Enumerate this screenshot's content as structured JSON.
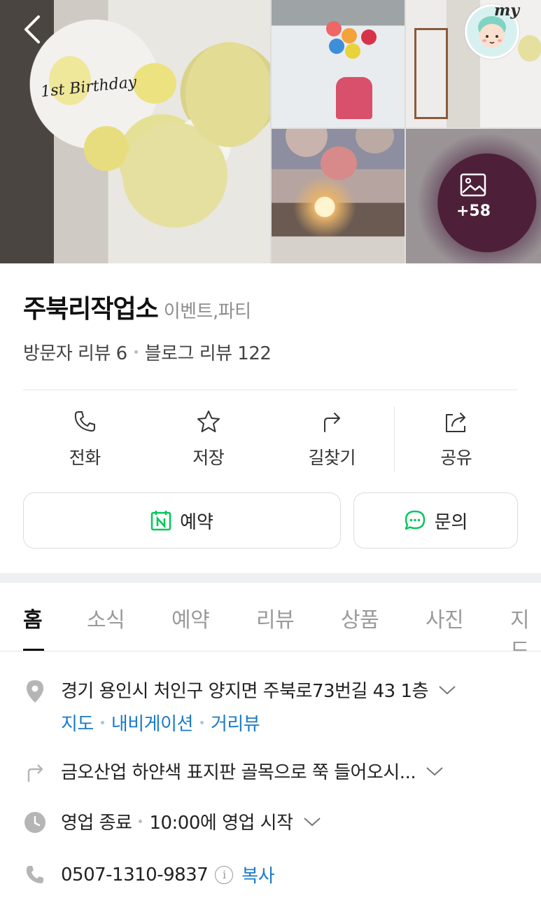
{
  "gallery": {
    "main_photo_caption": "1st Birthday",
    "more_photos_count": "+58",
    "my_label": "my"
  },
  "place": {
    "name": "주북리작업소",
    "category": "이벤트,파티",
    "visitor_reviews": "방문자 리뷰 6",
    "blog_reviews": "블로그 리뷰 122"
  },
  "actions": [
    {
      "label": "전화",
      "icon": "phone-icon"
    },
    {
      "label": "저장",
      "icon": "star-icon"
    },
    {
      "label": "길찾기",
      "icon": "directions-icon"
    },
    {
      "label": "공유",
      "icon": "share-icon"
    }
  ],
  "buttons": {
    "reserve": "예약",
    "inquiry": "문의"
  },
  "tabs": [
    "홈",
    "소식",
    "예약",
    "리뷰",
    "상품",
    "사진",
    "지도"
  ],
  "active_tab": "홈",
  "details": {
    "address": "경기 용인시 처인구 양지면 주북로73번길 43 1층",
    "links": [
      "지도",
      "내비게이션",
      "거리뷰"
    ],
    "directions": "금오산업 하얀색 표지판 골목으로 쭉 들어오시...",
    "hours_status": "영업 종료",
    "hours_next": "10:00에 영업 시작",
    "phone": "0507-1310-9837",
    "copy_label": "복사"
  },
  "colors": {
    "link": "#1b7ac9",
    "naver_green": "#03c75a",
    "icon_gray": "#9a9a9a"
  }
}
